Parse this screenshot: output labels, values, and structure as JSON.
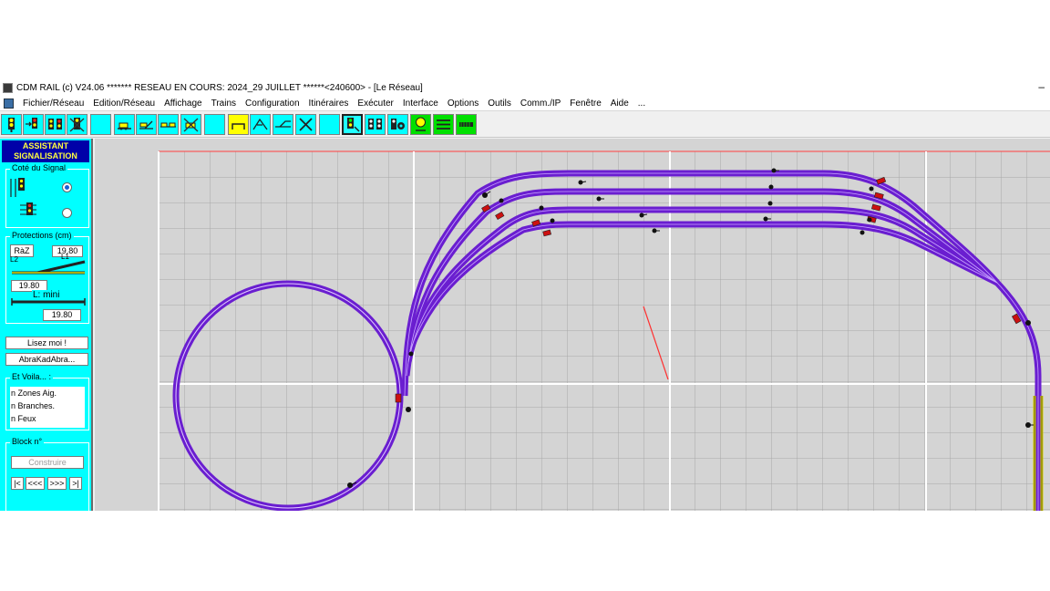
{
  "titlebar": {
    "text": "CDM RAIL (c) V24.06      ******* RESEAU EN COURS: 2024_29 JUILLET ******<240600> - [Le Réseau]",
    "minimize": "–"
  },
  "menu": [
    "Fichier/Réseau",
    "Edition/Réseau",
    "Affichage",
    "Trains",
    "Configuration",
    "Itinéraires",
    "Exécuter",
    "Interface",
    "Options",
    "Outils",
    "Comm./IP",
    "Fenêtre",
    "Aide",
    "..."
  ],
  "toolbar_icons": [
    "signal-yellow-icon",
    "signal-arrow-icon",
    "signal-double-icon",
    "signal-cross-icon",
    "blank-tool-icon",
    "loco-route-icon",
    "loco-switch-icon",
    "loco-link-icon",
    "loco-cross-icon",
    "blank-tool-icon-2",
    "turnout-icon",
    "turnout-branch-icon",
    "turnout-join-icon",
    "delete-cross-icon",
    "blank-tool-icon-3",
    "signal-edit-icon",
    "signal-pair-icon",
    "signal-gear-icon",
    "signal-assist-icon",
    "track-lines-icon",
    "track-bar-icon"
  ],
  "panel": {
    "header_line1": "ASSISTANT",
    "header_line2": "SIGNALISATION",
    "side_group": "Coté du Signal",
    "protections_group": "Protections (cm)",
    "raz_button": "RàZ",
    "l1_value": "19.80",
    "l2_label": "L2",
    "l1_label": "L1",
    "l2_value": "19.80",
    "lmini_label": "L: mini",
    "lmini_value": "19.80",
    "lisez_button": "Lisez moi !",
    "abra_button": "AbraKadAbra...",
    "voila_group": "Et Voila... :",
    "zones_text": "n Zones Aig.",
    "branches_text": "n Branches.",
    "feux_text": "n Feux",
    "block_group": "Block n°",
    "construire_button": "Construire",
    "nav_first": "|<",
    "nav_prev": "<<<",
    "nav_next": ">>>",
    "nav_last": ">|"
  },
  "colors": {
    "track": "#6a1ed0",
    "track_rail": "#c9a6ff",
    "panel_bg": "#00ffff",
    "header_bg": "#0000a8",
    "accent_yellow": "#ffff00",
    "grid": "#a8a8a8",
    "major_grid": "#ffffff",
    "red_line": "#ff4040"
  }
}
